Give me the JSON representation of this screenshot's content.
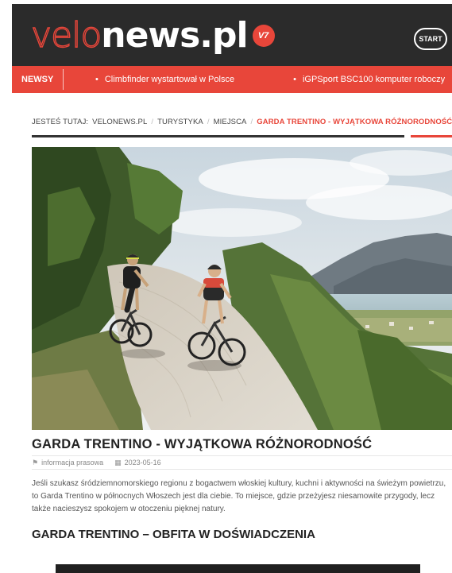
{
  "header": {
    "logo_part1": "velo",
    "logo_part2": "news.pl",
    "logo_badge": "V7",
    "start_label": "START",
    "colors": {
      "brand_red": "#e8463a",
      "header_bg": "#2b2b2b"
    }
  },
  "ticker": {
    "label": "NEWSY",
    "items": [
      "Climbfinder wystartował w Polsce",
      "iGPSport BSC100 komputer roboczy"
    ]
  },
  "breadcrumb": {
    "prefix": "JESTEŚ TUTAJ:",
    "items": [
      "VELONEWS.PL",
      "TURYSTYKA",
      "MIEJSCA"
    ],
    "current": "GARDA TRENTINO - WYJĄTKOWA RÓŻNORODNOŚĆ"
  },
  "article": {
    "title": "GARDA TRENTINO - WYJĄTKOWA RÓŻNORODNOŚĆ",
    "author": "informacja prasowa",
    "date": "2023-05-16",
    "lead": "Jeśli szukasz śródziemnomorskiego regionu z bogactwem włoskiej kultury, kuchni i aktywności na świeżym powietrzu, to Garda Trentino w północnych Włoszech jest dla ciebie. To miejsce, gdzie przeżyjesz niesamowite przygody, lecz także nacieszysz spokojem w otoczeniu pięknej natury.",
    "subtitle": "GARDA TRENTINO – OBFITA W DOŚWIADCZENIA"
  }
}
